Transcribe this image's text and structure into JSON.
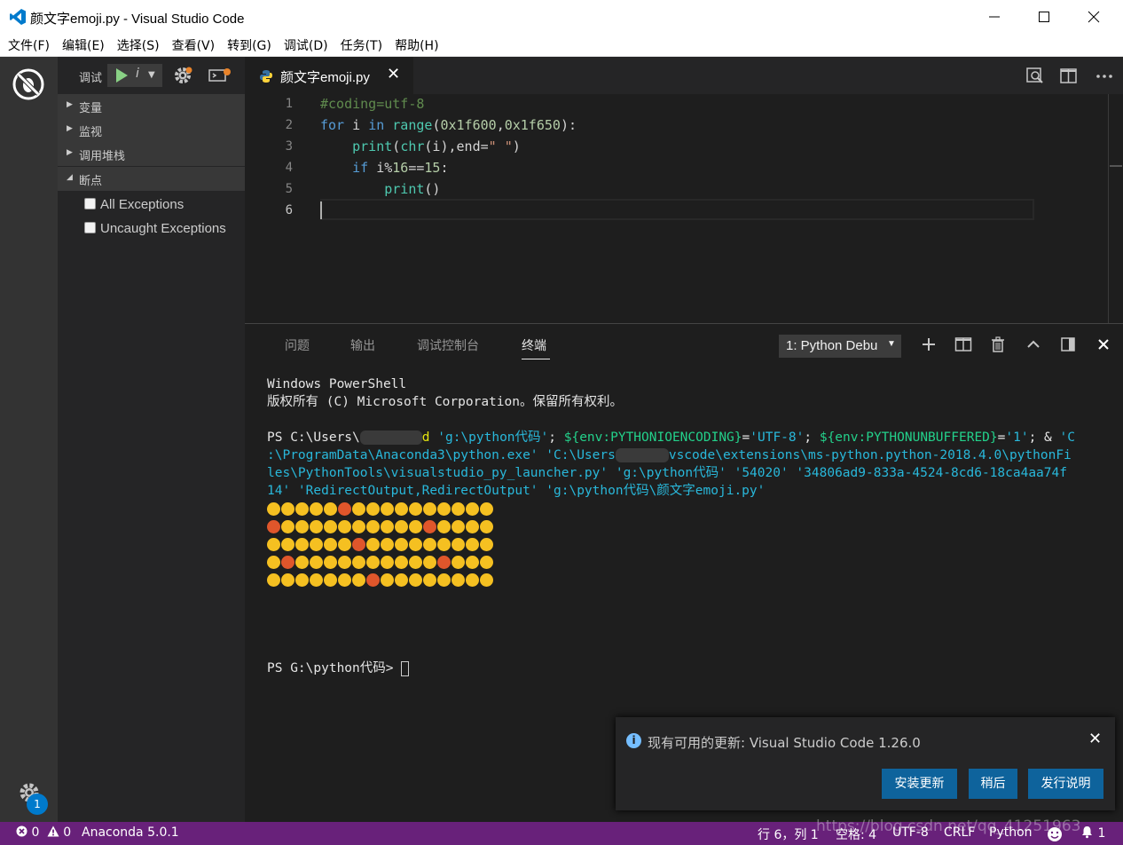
{
  "window": {
    "title": "颜文字emoji.py - Visual Studio Code"
  },
  "menu": [
    "文件(F)",
    "编辑(E)",
    "选择(S)",
    "查看(V)",
    "转到(G)",
    "调试(D)",
    "任务(T)",
    "帮助(H)"
  ],
  "activity": {
    "badge": "1"
  },
  "sidebar": {
    "toolbar_label": "调试",
    "config_name": "i",
    "sections": [
      {
        "title": "变量",
        "expanded": false
      },
      {
        "title": "监视",
        "expanded": false
      },
      {
        "title": "调用堆栈",
        "expanded": false
      },
      {
        "title": "断点",
        "expanded": true
      }
    ],
    "breakpoints": [
      {
        "label": "All Exceptions",
        "checked": false
      },
      {
        "label": "Uncaught Exceptions",
        "checked": false
      }
    ]
  },
  "editor": {
    "tab_label": "颜文字emoji.py",
    "line_numbers": [
      "1",
      "2",
      "3",
      "4",
      "5",
      "6"
    ],
    "code": {
      "l1": "#coding=utf-8",
      "l2_kw1": "for",
      "l2_a": " i ",
      "l2_kw2": "in",
      "l2_sp": " ",
      "l2_fn": "range",
      "l2_p1": "(",
      "l2_n1": "0x1f600",
      "l2_c": ",",
      "l2_n2": "0x1f650",
      "l2_p2": "):",
      "l3_ind": "    ",
      "l3_fn": "print",
      "l3_a": "(",
      "l3_fn2": "chr",
      "l3_b": "(i),end=",
      "l3_s": "\" \"",
      "l3_c": ")",
      "l4_ind": "    ",
      "l4_kw": "if",
      "l4_a": " i%",
      "l4_n1": "16",
      "l4_b": "==",
      "l4_n2": "15",
      "l4_c": ":",
      "l5_ind": "        ",
      "l5_fn": "print",
      "l5_a": "()"
    }
  },
  "panel": {
    "tabs": [
      "问题",
      "输出",
      "调试控制台",
      "终端"
    ],
    "active_tab": "终端",
    "terminal_select": "1: Python Debu",
    "terminal": {
      "line1": "Windows PowerShell",
      "line2": "版权所有 (C) Microsoft Corporation。保留所有权利。",
      "ps_prefix": "PS C:\\Users\\",
      "ps_after_blur": "d ",
      "arg1": "'g:\\python代码'",
      "semi1": "; ",
      "env1": "${env:PYTHONIOENCODING}",
      "eq1": "=",
      "val1": "'UTF-8'",
      "semi2": "; ",
      "env2": "${env:PYTHONUNBUFFERED}",
      "eq2": "=",
      "val2": "'1'",
      "amp": "; & ",
      "c_start": "'C",
      "cont1": ":\\ProgramData\\Anaconda3\\python.exe' 'C:\\Users",
      "cont1b": "vscode\\extensions\\ms-python.python-2018.4.0\\pythonFi",
      "cont2": "les\\PythonTools\\visualstudio_py_launcher.py' 'g:\\python代码' '54020' '34806ad9-833a-4524-8cd6-18ca4aa74f",
      "cont3": "14' 'RedirectOutput,RedirectOutput' 'g:\\python代码\\颜文字emoji.py'",
      "prompt": "PS G:\\python代码> "
    }
  },
  "notification": {
    "message": "现有可用的更新: Visual Studio Code 1.26.0",
    "buttons": [
      "安装更新",
      "稍后",
      "发行说明"
    ]
  },
  "statusbar": {
    "errors": "0",
    "warnings": "0",
    "interpreter": "Anaconda 5.0.1",
    "position": "行 6，列 1",
    "indent": "空格: 4",
    "encoding": "UTF-8",
    "eol": "CRLF",
    "language": "Python",
    "notifications": "1"
  },
  "colors": {
    "statusbar": "#68217a",
    "accent": "#007acc",
    "button": "#0e639c"
  },
  "watermark": "https://blog.csdn.net/qq_41251963"
}
